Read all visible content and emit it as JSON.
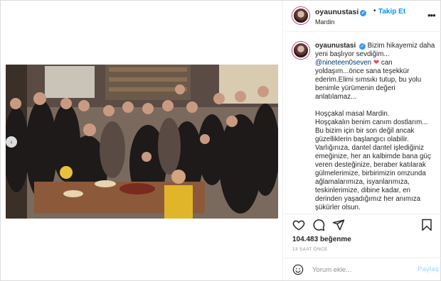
{
  "post": {
    "username": "oyaunustasi",
    "follow_label": "Takip Et",
    "separator": "•",
    "location": "Mardin",
    "more_label": "•••",
    "prev_label": "‹"
  },
  "caption": {
    "username": "oyaunustasi",
    "line1": "Bizim hikayemiz daha yeni başlıyor sevdiğim...",
    "mention": "@nineteen0seven",
    "heart": "❤",
    "line2": "can yoldaşım...önce sana teşekkür ederim.Elimi sımsıkı tutup, bu yolu benimle yürümenin değeri anlatılamaz...",
    "para2_a": "Hoşçakal masal Mardin.",
    "para2_b": "Hoşçakalın benim canım dostlarım... Bu bizim için bir son değil ancak güzelliklerin başlangıcı olabilir. Varlığınıza, dantel dantel işlediğiniz emeğinize, her an kalbimde bana güç veren desteğinize, beraber katılarak gülmelerimize, birbirimizin omzunda ağlamalarımıza, isyanlarımıza, teskinlerimize, dibine kadar, en derinden yaşadığımız her anımıza şükürler olsun."
  },
  "stats": {
    "likes_count": "104.483",
    "likes_word": "beğenme",
    "time_ago": "13 SAAT ÖNCE"
  },
  "comment": {
    "placeholder": "Yorum ekle...",
    "submit_label": "Paylaş"
  },
  "colors": {
    "accent": "#0095f6",
    "heart": "#ed4956",
    "mention": "#00376b",
    "muted": "#8e8e8e"
  },
  "icons": [
    "heart-outline-icon",
    "comment-icon",
    "share-icon",
    "bookmark-icon",
    "emoji-icon",
    "verified-icon",
    "more-icon",
    "chevron-left-icon"
  ]
}
